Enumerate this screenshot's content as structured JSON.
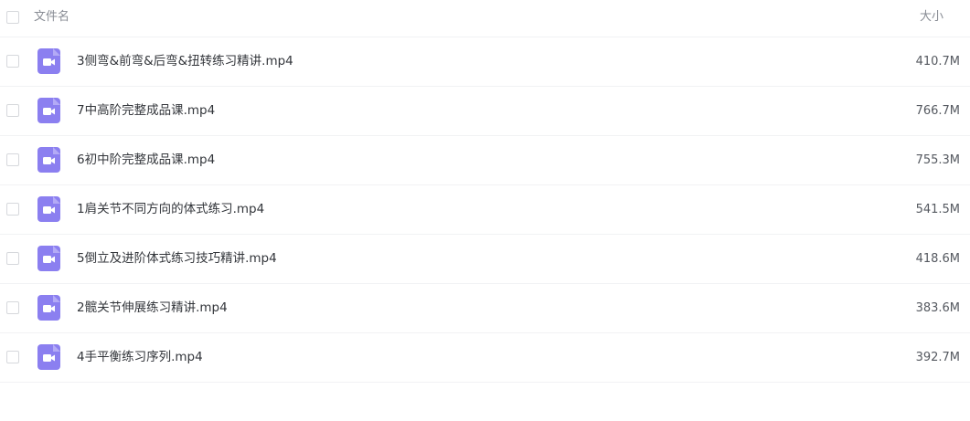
{
  "header": {
    "name_label": "文件名",
    "size_label": "大小"
  },
  "colors": {
    "video_icon": "#8b7ff0",
    "row_divider": "#f1f2f4"
  },
  "files": [
    {
      "name": "3侧弯&前弯&后弯&扭转练习精讲.mp4",
      "size": "410.7M",
      "icon": "video-file-icon"
    },
    {
      "name": "7中高阶完整成品课.mp4",
      "size": "766.7M",
      "icon": "video-file-icon"
    },
    {
      "name": "6初中阶完整成品课.mp4",
      "size": "755.3M",
      "icon": "video-file-icon"
    },
    {
      "name": "1肩关节不同方向的体式练习.mp4",
      "size": "541.5M",
      "icon": "video-file-icon"
    },
    {
      "name": "5倒立及进阶体式练习技巧精讲.mp4",
      "size": "418.6M",
      "icon": "video-file-icon"
    },
    {
      "name": "2髋关节伸展练习精讲.mp4",
      "size": "383.6M",
      "icon": "video-file-icon"
    },
    {
      "name": "4手平衡练习序列.mp4",
      "size": "392.7M",
      "icon": "video-file-icon"
    }
  ]
}
